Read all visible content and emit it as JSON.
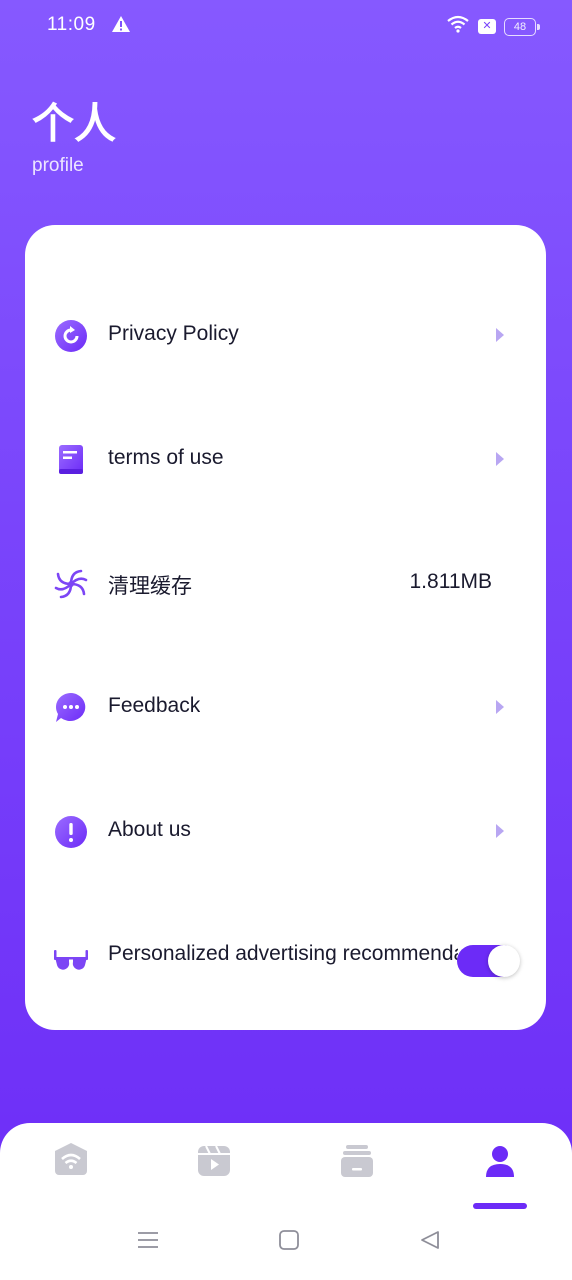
{
  "status": {
    "time": "11:09",
    "battery": "48"
  },
  "header": {
    "title": "个人",
    "subtitle": "profile"
  },
  "menu": {
    "privacy_label": "Privacy Policy",
    "terms_label": "terms of use",
    "cache_label": "清理缓存",
    "cache_size": "1.811MB",
    "feedback_label": "Feedback",
    "about_label": "About us",
    "ads_label": "Personalized advertising recommendation",
    "ads_enabled": true
  },
  "tabbar": {
    "tabs": [
      "wifi-home-icon",
      "video-icon",
      "files-icon",
      "profile-icon"
    ],
    "active_tab": 3
  },
  "colors": {
    "accent": "#6c2bf7",
    "arrow": "#b8a6f2",
    "inactive_icon": "#c9c9d1"
  }
}
